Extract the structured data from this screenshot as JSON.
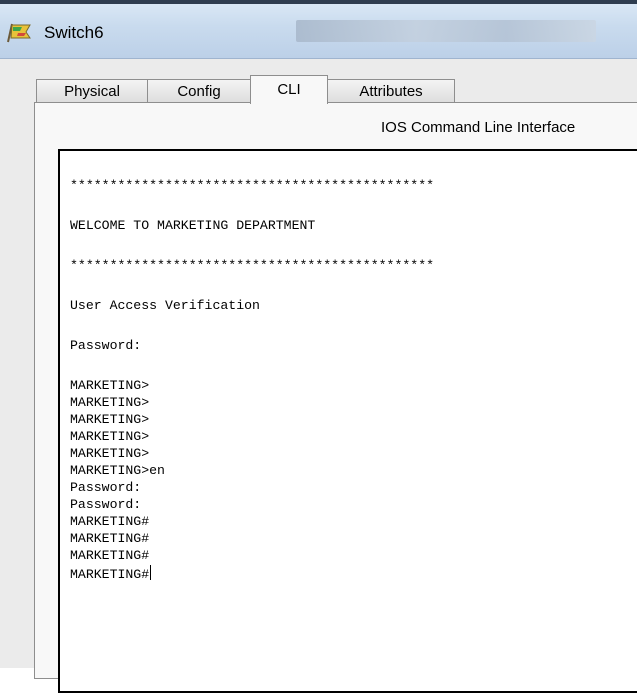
{
  "window": {
    "title": "Switch6",
    "app_icon": "packet-tracer-device-icon"
  },
  "tabs": [
    {
      "label": "Physical",
      "active": false
    },
    {
      "label": "Config",
      "active": false
    },
    {
      "label": "CLI",
      "active": true
    },
    {
      "label": "Attributes",
      "active": false
    }
  ],
  "panel": {
    "title": "IOS Command Line Interface"
  },
  "terminal": {
    "lines": [
      "**********************************************",
      "WELCOME TO MARKETING DEPARTMENT",
      "**********************************************",
      "User Access Verification",
      "Password:",
      "MARKETING>",
      "MARKETING>",
      "MARKETING>",
      "MARKETING>",
      "MARKETING>",
      "MARKETING>en",
      "Password:",
      "Password:",
      "MARKETING#",
      "MARKETING#",
      "MARKETING#",
      "MARKETING#"
    ]
  }
}
